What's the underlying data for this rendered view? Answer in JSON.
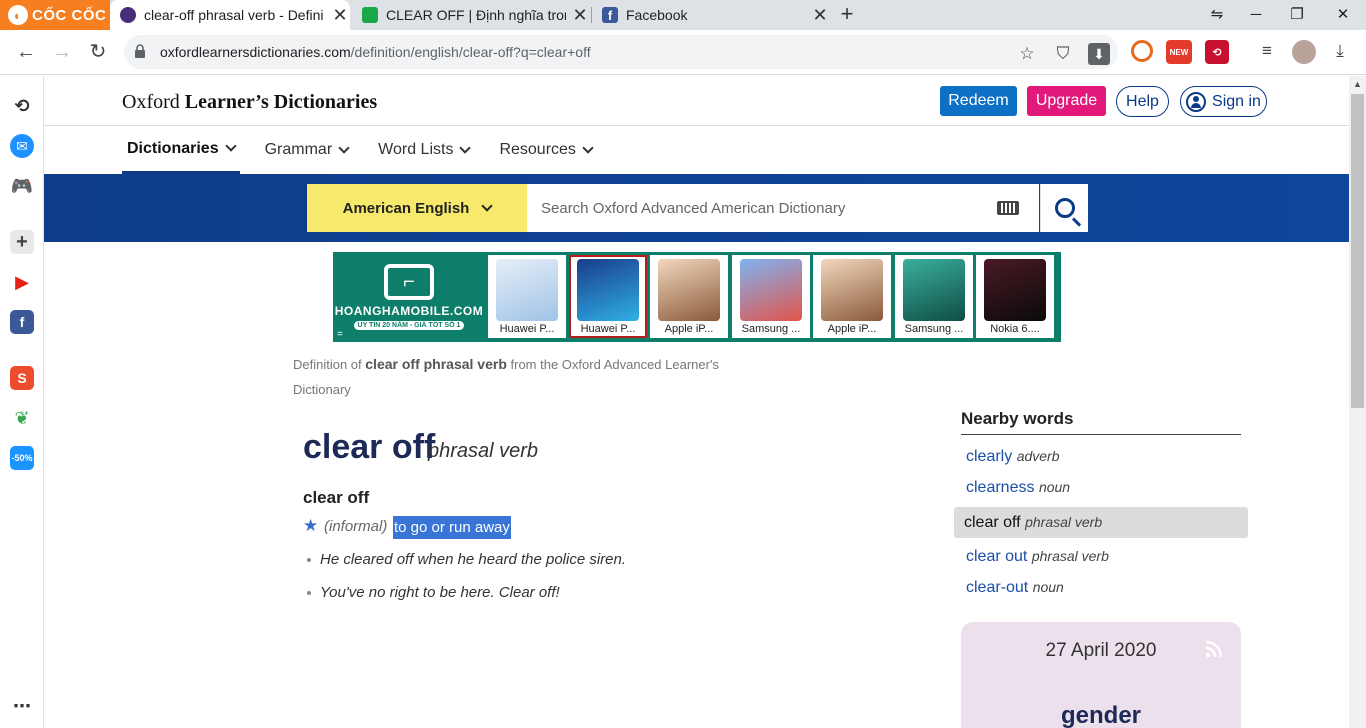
{
  "browser": {
    "brand": "CỐC CỐC",
    "tabs": [
      {
        "title": "clear-off phrasal verb - Defini",
        "favicon_color": "#4a2d7a",
        "active": true
      },
      {
        "title": "CLEAR OFF | Định nghĩa trong",
        "favicon_color": "#1aa84b",
        "active": false
      },
      {
        "title": "Facebook",
        "favicon_color": "#3b5998",
        "active": false
      }
    ],
    "new_tab": "+",
    "url_host": "oxfordlearnersdictionaries.com",
    "url_path": "/definition/english/clear-off?q=clear+off",
    "ext_new_badge": "NEW"
  },
  "header": {
    "logo_light": "Oxford ",
    "logo_bold": "Learner’s Dictionaries",
    "redeem": "Redeem",
    "upgrade": "Upgrade",
    "help": "Help",
    "signin": "Sign in"
  },
  "nav": [
    "Dictionaries",
    "Grammar",
    "Word Lists",
    "Resources"
  ],
  "search": {
    "dictionary": "American English",
    "placeholder": "Search Oxford Advanced American Dictionary"
  },
  "ad": {
    "brand": "HOANGHAMOBILE.COM",
    "tagline": "UY TÍN 20 NĂM - GIÁ TỐT SỐ 1",
    "corner": "=",
    "phones": [
      {
        "label": "Huawei P...",
        "color": "#bcd4ea"
      },
      {
        "label": "Huawei P...",
        "color": "#2f8fd6"
      },
      {
        "label": "Apple iP...",
        "color": "#d7b48e"
      },
      {
        "label": "Samsung ...",
        "color": "#3f7fd0"
      },
      {
        "label": "Apple iP...",
        "color": "#d7b48e"
      },
      {
        "label": "Samsung ...",
        "color": "#2f8f80"
      },
      {
        "label": "Nokia 6....",
        "color": "#2a1a20"
      }
    ]
  },
  "entry": {
    "source_prefix": "Definition of ",
    "source_term": "clear off phrasal verb",
    "source_suffix": " from the Oxford Advanced Learner's Dictionary",
    "headword": "clear off",
    "pos": "phrasal verb",
    "sense_head": "clear off",
    "label": "(informal)",
    "definition": "to go or run away",
    "examples": [
      "He cleared off when he heard the police siren.",
      "You've no right to be here. Clear off!"
    ]
  },
  "nearby": {
    "heading": "Nearby words",
    "items": [
      {
        "word": "clearly",
        "pos": "adverb"
      },
      {
        "word": "clearness",
        "pos": "noun"
      },
      {
        "word": "clear off",
        "pos": "phrasal verb"
      },
      {
        "word": "clear out",
        "pos": "phrasal verb"
      },
      {
        "word": "clear-out",
        "pos": "noun"
      }
    ]
  },
  "word_of_day": {
    "date": "27 April 2020",
    "word": "gender"
  },
  "colors": {
    "brand_blue": "#0b3a89",
    "redeem": "#0d70c4",
    "upgrade": "#e2197a",
    "dict_yellow": "#f6e96b",
    "highlight": "#3875d7",
    "coccoc_orange": "#f77f1f"
  }
}
